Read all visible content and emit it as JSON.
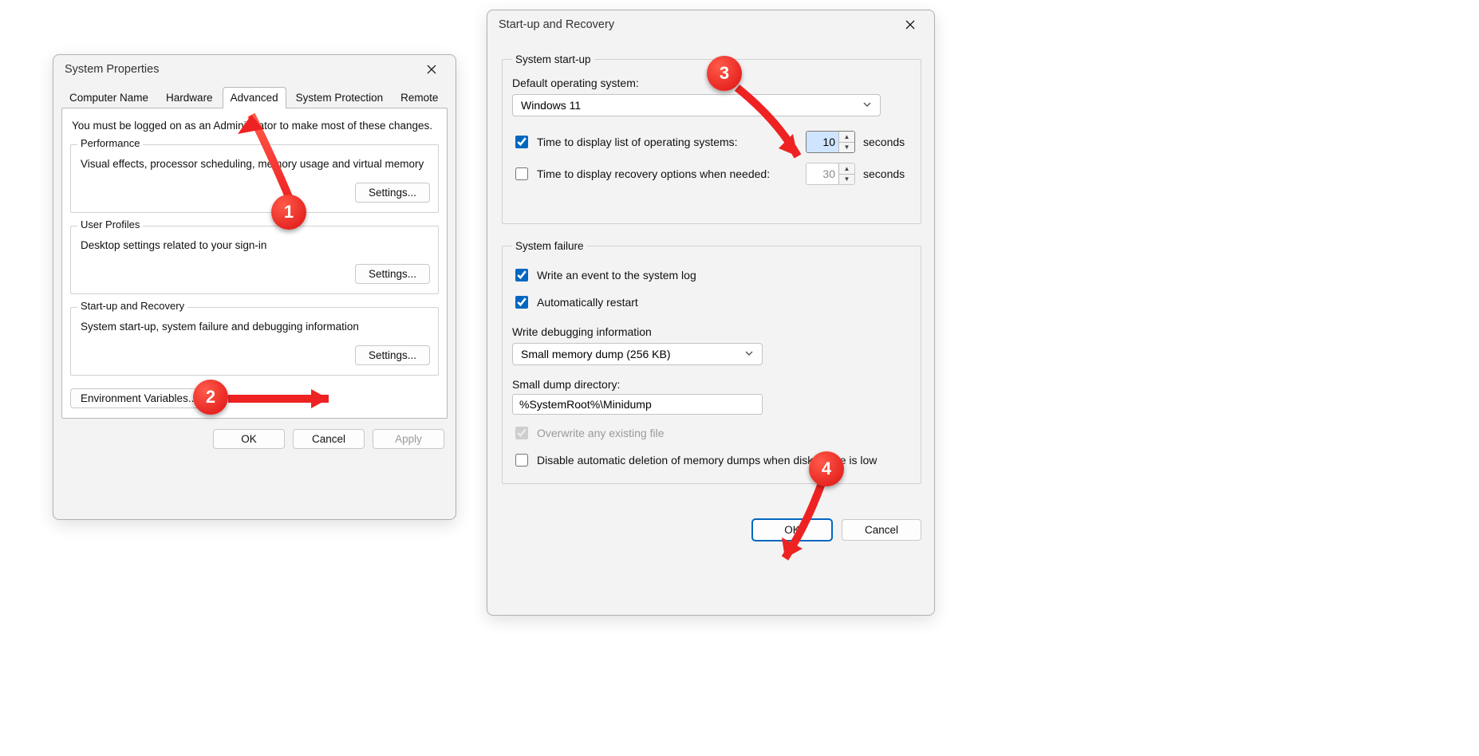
{
  "system_properties": {
    "title": "System Properties",
    "tabs": [
      "Computer Name",
      "Hardware",
      "Advanced",
      "System Protection",
      "Remote"
    ],
    "active_tab_index": 2,
    "hint": "You must be logged on as an Administrator to make most of these changes.",
    "performance": {
      "legend": "Performance",
      "desc": "Visual effects, processor scheduling, memory usage and virtual memory",
      "button": "Settings..."
    },
    "user_profiles": {
      "legend": "User Profiles",
      "desc": "Desktop settings related to your sign-in",
      "button": "Settings..."
    },
    "startup_recovery": {
      "legend": "Start-up and Recovery",
      "desc": "System start-up, system failure and debugging information",
      "button": "Settings..."
    },
    "env_button": "Environment Variables...",
    "footer": {
      "ok": "OK",
      "cancel": "Cancel",
      "apply": "Apply"
    }
  },
  "startup_recovery_dialog": {
    "title": "Start-up and Recovery",
    "system_startup": {
      "legend": "System start-up",
      "default_os_label": "Default operating system:",
      "default_os_value": "Windows 11",
      "display_list": {
        "label": "Time to display list of operating systems:",
        "checked": true,
        "value": "10",
        "unit": "seconds"
      },
      "display_recovery": {
        "label": "Time to display recovery options when needed:",
        "checked": false,
        "value": "30",
        "unit": "seconds"
      }
    },
    "system_failure": {
      "legend": "System failure",
      "write_event": {
        "label": "Write an event to the system log",
        "checked": true
      },
      "auto_restart": {
        "label": "Automatically restart",
        "checked": true
      },
      "write_debug_label": "Write debugging information",
      "debug_dropdown": "Small memory dump (256 KB)",
      "dump_dir_label": "Small dump directory:",
      "dump_dir_value": "%SystemRoot%\\Minidump",
      "overwrite": {
        "label": "Overwrite any existing file",
        "checked": true
      },
      "disable_auto_delete": {
        "label": "Disable automatic deletion of memory dumps when disk space is low",
        "checked": false
      }
    },
    "footer": {
      "ok": "OK",
      "cancel": "Cancel"
    }
  },
  "markers": {
    "m1": "1",
    "m2": "2",
    "m3": "3",
    "m4": "4"
  }
}
